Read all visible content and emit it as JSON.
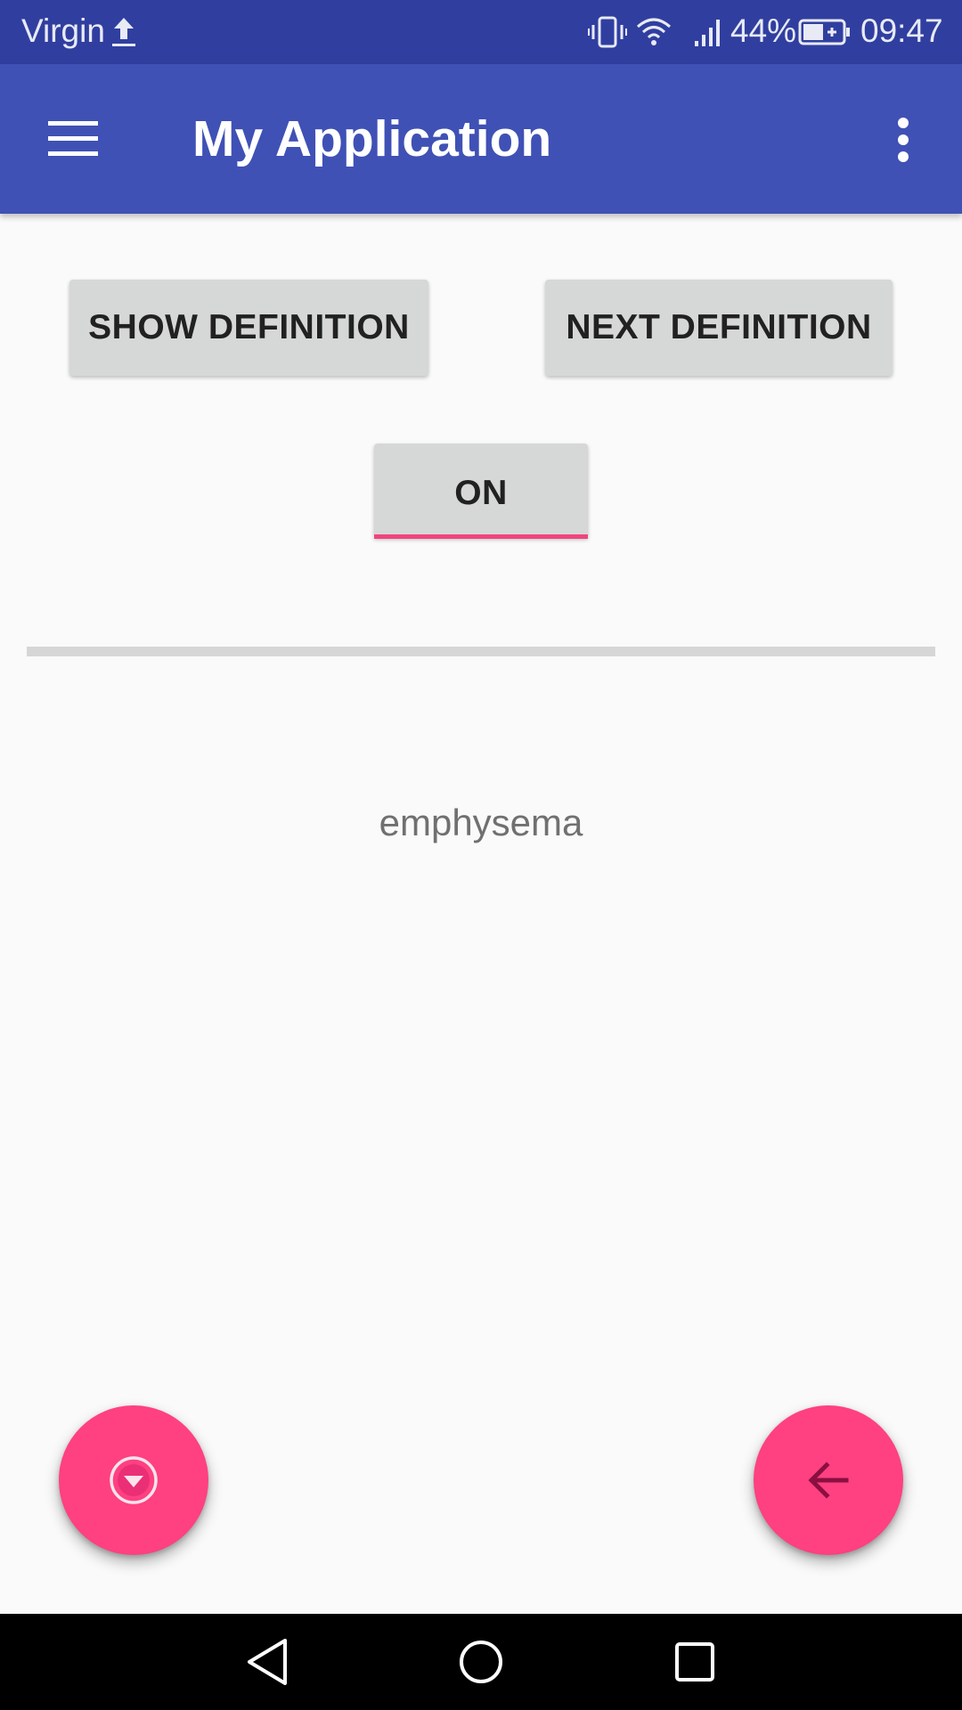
{
  "status_bar": {
    "carrier": "Virgin",
    "battery_percent": "44%",
    "time": "09:47",
    "icons": [
      "upload-icon",
      "vibrate-icon",
      "wifi-icon",
      "signal-icon",
      "battery-charging-icon"
    ]
  },
  "app_bar": {
    "title": "My Application",
    "menu_icon": "hamburger-menu-icon",
    "overflow_icon": "more-vert-icon",
    "color": "#3f51b5"
  },
  "buttons": {
    "show_definition": "SHOW DEFINITION",
    "next_definition": "NEXT DEFINITION",
    "toggle": "ON"
  },
  "content": {
    "word": "emphysema"
  },
  "fabs": {
    "left_icon": "arrow-drop-down-circle-icon",
    "right_icon": "arrow-back-icon",
    "color": "#ff4081"
  },
  "nav_bar": {
    "icons": [
      "back-triangle-icon",
      "home-circle-icon",
      "recents-square-icon"
    ]
  },
  "colors": {
    "status_bar": "#303f9f",
    "accent": "#ff4081",
    "button_bg": "#d6d7d7",
    "background": "#fafafa"
  }
}
